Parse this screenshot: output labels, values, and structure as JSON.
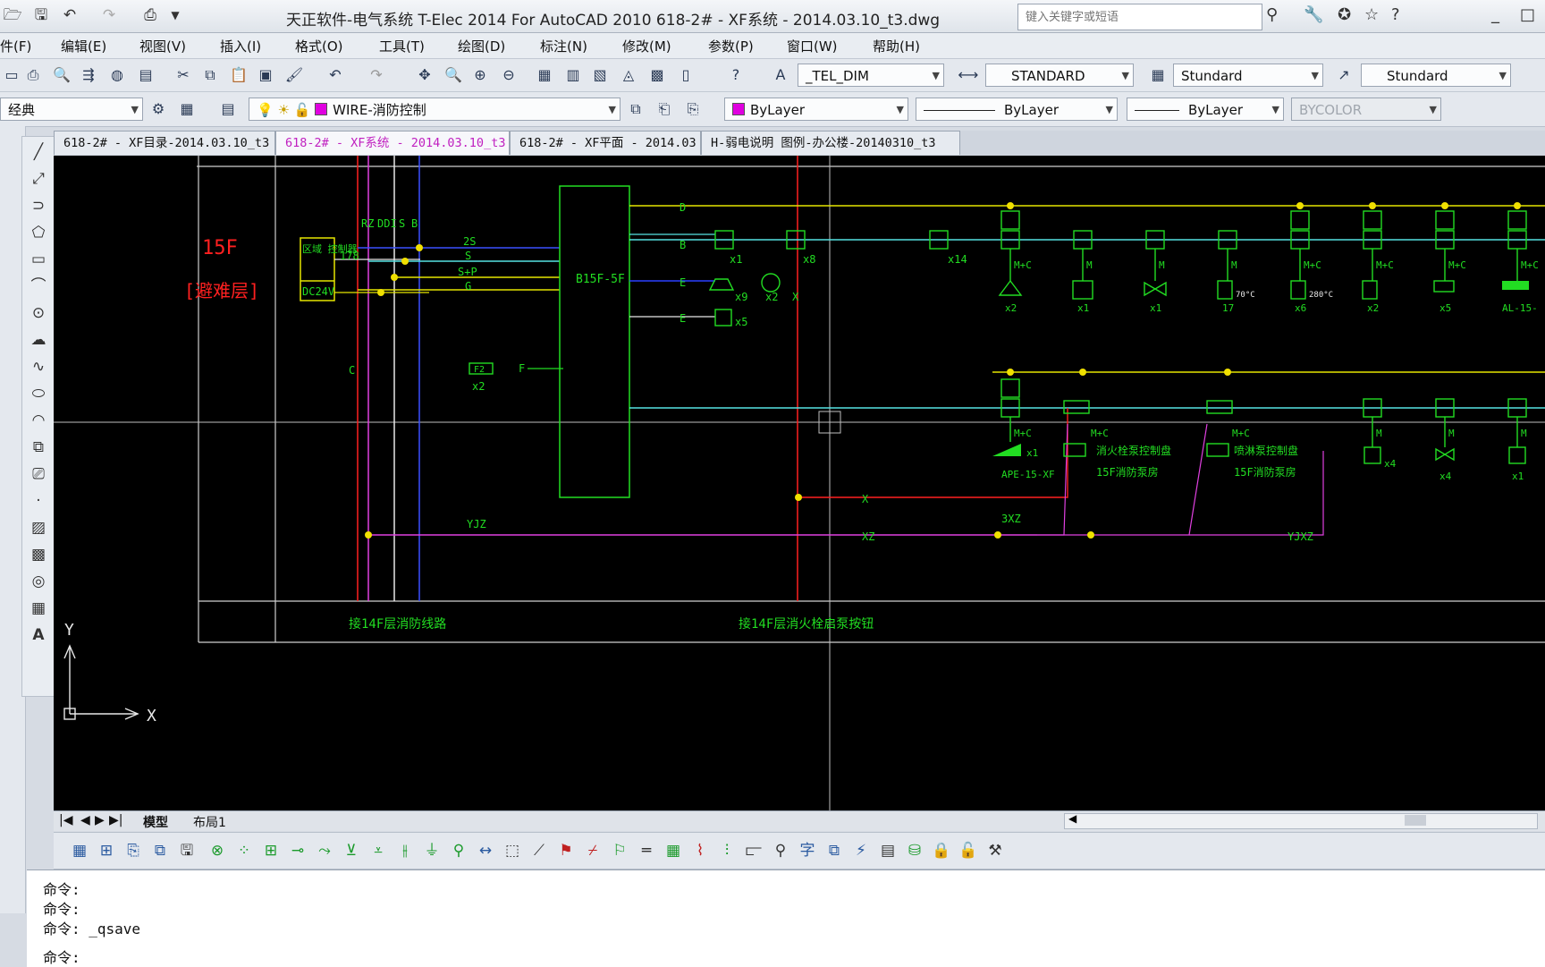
{
  "window": {
    "title": "天正软件-电气系统 T-Elec 2014  For AutoCAD 2010        618-2# - XF系统 - 2014.03.10_t3.dwg",
    "search_placeholder": "键入关键字或短语"
  },
  "menu": [
    "件(F)",
    "编辑(E)",
    "视图(V)",
    "插入(I)",
    "格式(O)",
    "工具(T)",
    "绘图(D)",
    "标注(N)",
    "修改(M)",
    "参数(P)",
    "窗口(W)",
    "帮助(H)"
  ],
  "toolbar1": {
    "text_style": "_TEL_DIM",
    "dim_style": "STANDARD",
    "table_style": "Stundard",
    "mleader_style": "Stundard"
  },
  "toolbar2": {
    "workspace": "经典",
    "layer": "WIRE-消防控制",
    "color": "ByLayer",
    "linetype": "ByLayer",
    "lineweight": "ByLayer",
    "plotstyle": "BYCOLOR"
  },
  "doc_tabs": [
    {
      "label": "618-2# - XF目录-2014.03.10_t3",
      "active": false
    },
    {
      "label": "618-2# - XF系统 - 2014.03.10_t3",
      "active": true
    },
    {
      "label": "618-2# - XF平面 - 2014.03",
      "active": false
    },
    {
      "label": "H-弱电说明 图例-办公楼-20140310_t3",
      "active": false
    }
  ],
  "drawing": {
    "floor": "15F",
    "floor_note": "[避难层]",
    "module_label": "区域\n控制器",
    "module_power": "DC24V",
    "riser_labels": [
      "RZ",
      "DDI",
      "S",
      "B"
    ],
    "bus_labels": [
      "2S",
      "S",
      "S+P",
      "G"
    ],
    "box_label": "B15F-5F",
    "row_labels": [
      "D",
      "B",
      "E",
      "E"
    ],
    "label_178": "178",
    "fire_phone": "F2",
    "fire_phone_qty": "x2",
    "label_f": "F",
    "label_c": "C",
    "label_x": "X",
    "label_x8": "x8",
    "label_x14": "x14",
    "label_x1_a": "x1",
    "label_x9": "x9",
    "label_x2_a": "x2",
    "label_x5": "x5",
    "label_yjz": "YJZ",
    "label_xz": "XZ",
    "label_3xz": "3XZ",
    "label_yjxz": "YJXZ",
    "top_devices": [
      {
        "tag": "M+C",
        "qty": "x2"
      },
      {
        "tag": "M",
        "qty": "x1"
      },
      {
        "tag": "M",
        "qty": "x1"
      },
      {
        "tag": "M",
        "qty": "17",
        "temp": "70°C"
      },
      {
        "tag": "M+C",
        "qty": "x6",
        "temp": "280°C"
      },
      {
        "tag": "M+C",
        "qty": "x2"
      },
      {
        "tag": "M+C",
        "qty": "x5"
      },
      {
        "tag": "M+C",
        "qty": "AL-15-"
      }
    ],
    "lower_devices": [
      {
        "tag": "M+C",
        "qty": "x1",
        "note": "APE-15-XF"
      },
      {
        "tag": "M+C",
        "note1": "消火栓泵控制盘",
        "note2": "15F消防泵房"
      },
      {
        "tag": "M+C",
        "note1": "喷淋泵控制盘",
        "note2": "15F消防泵房"
      },
      {
        "tag": "M",
        "qty": "x4"
      },
      {
        "tag": "M",
        "qty": "x4"
      },
      {
        "tag": "M",
        "qty": "x1"
      }
    ],
    "bottom_left": "接14F层消防线路",
    "bottom_mid": "接14F层消火栓启泵按钮",
    "ucs_y": "Y",
    "ucs_x": "X"
  },
  "layout_tabs": [
    "模型",
    "布局1"
  ],
  "command_lines": [
    "命令:",
    "命令:",
    "命令: _qsave",
    "命令:"
  ]
}
